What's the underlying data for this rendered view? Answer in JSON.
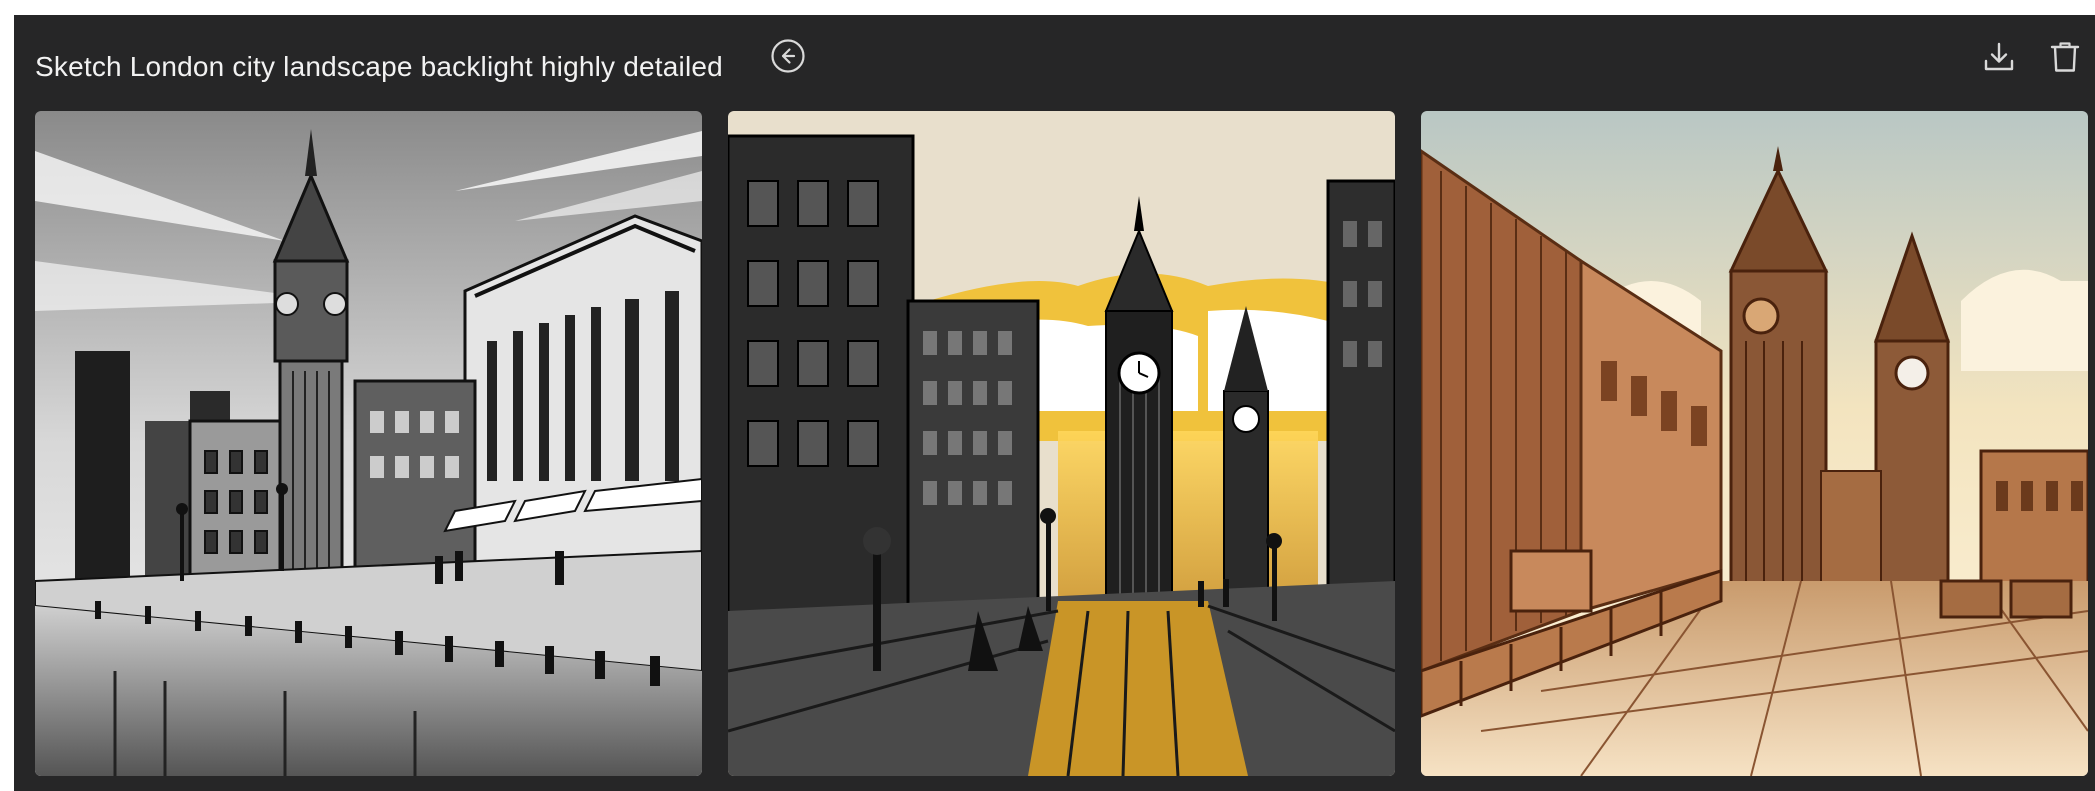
{
  "header": {
    "title": "Sketch London city landscape backlight highly detailed",
    "back_icon": "arrow-left-circle-icon",
    "download_icon": "download-icon",
    "delete_icon": "trash-icon"
  },
  "colors": {
    "panel_bg": "#262627",
    "text": "#f2f2f2",
    "icon": "#d9d9d9"
  },
  "images": [
    {
      "style": "black-and-white",
      "subject": "Big Ben riverside"
    },
    {
      "style": "ink-with-gold-sunset",
      "subject": "Big Ben street"
    },
    {
      "style": "sepia-orange-sketch",
      "subject": "Big Ben plaza"
    }
  ]
}
